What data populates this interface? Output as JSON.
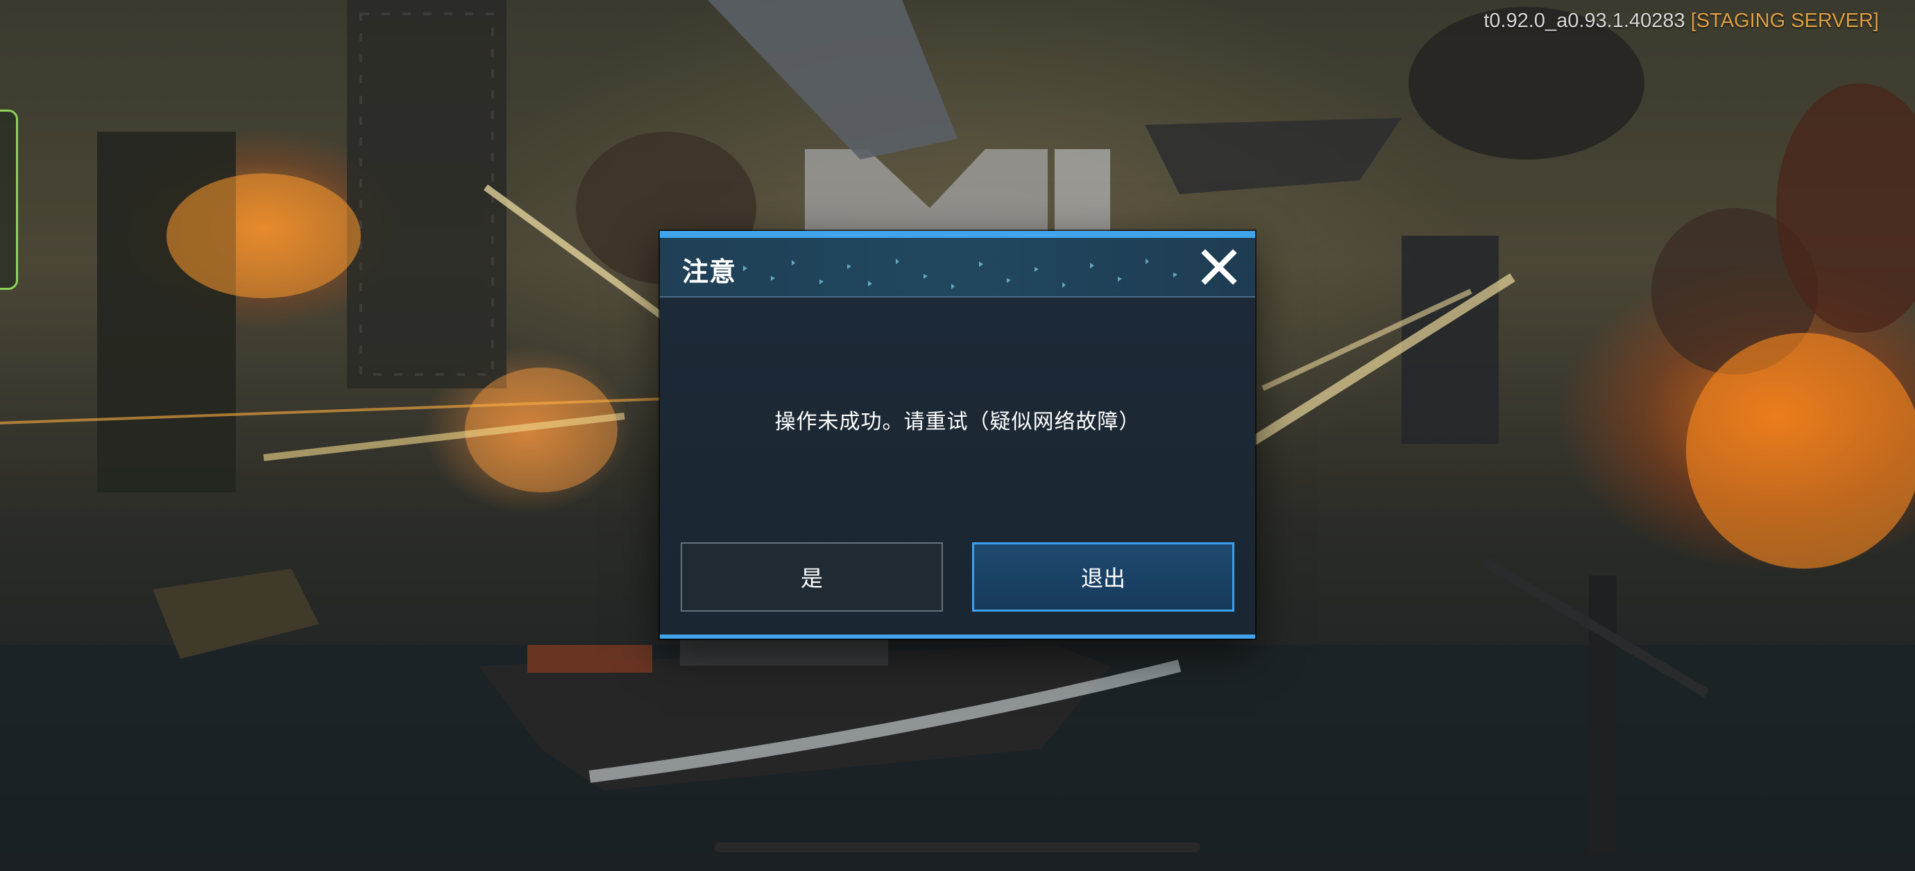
{
  "version": {
    "build": "t0.92.0_a0.93.1.40283",
    "server": "[STAGING SERVER]"
  },
  "dialog": {
    "title": "注意",
    "message": "操作未成功。请重试（疑似网络故障）",
    "confirm_label": "是",
    "quit_label": "退出",
    "close_icon": "close-x-icon"
  },
  "colors": {
    "accent": "#3fa4ec",
    "server_tag": "#e0a044",
    "left_tab_border": "#8fd45a"
  }
}
